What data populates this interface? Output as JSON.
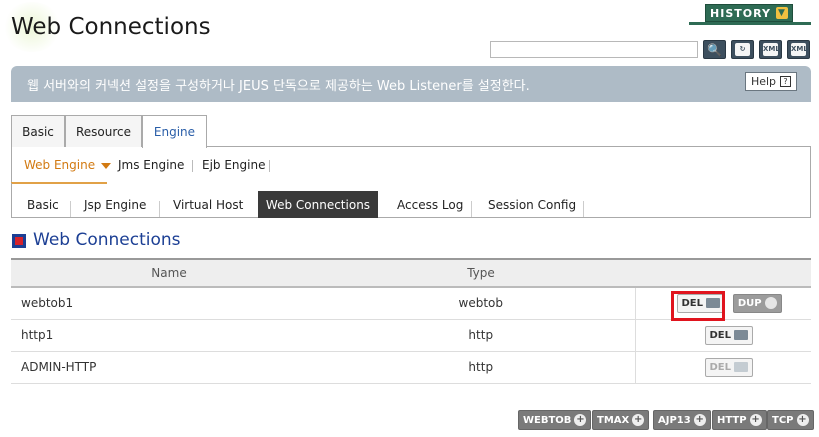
{
  "page_title": "Web Connections",
  "history_label": "HISTORY",
  "search": {
    "value": ""
  },
  "toolbar_icons": [
    "search-icon",
    "refresh-icon",
    "export-xml-icon",
    "import-xml-icon"
  ],
  "toolbar_xml": "XML",
  "banner": {
    "text": "웹 서버와의 커넥션 설정을 구성하거나 JEUS 단독으로 제공하는 Web Listener를 설정한다.",
    "help_label": "Help"
  },
  "tabs": [
    {
      "label": "Basic"
    },
    {
      "label": "Resource"
    },
    {
      "label": "Engine"
    }
  ],
  "engine_tabs": [
    {
      "label": "Web Engine"
    },
    {
      "label": "Jms Engine"
    },
    {
      "label": "Ejb Engine"
    }
  ],
  "web_tabs": [
    {
      "label": "Basic"
    },
    {
      "label": "Jsp Engine"
    },
    {
      "label": "Virtual Host"
    },
    {
      "label": "Web Connections"
    },
    {
      "label": "Access Log"
    },
    {
      "label": "Session Config"
    }
  ],
  "section_title": "Web Connections",
  "table": {
    "headers": [
      "Name",
      "Type"
    ],
    "rows": [
      {
        "name": "webtob1",
        "type": "webtob"
      },
      {
        "name": "http1",
        "type": "http"
      },
      {
        "name": "ADMIN-HTTP",
        "type": "http"
      }
    ]
  },
  "row_buttons": {
    "del": "DEL",
    "dup": "DUP"
  },
  "bottom_buttons": [
    "WEBTOB",
    "TMAX",
    "AJP13",
    "HTTP",
    "TCP"
  ],
  "colors": {
    "banner": "#aebbc6",
    "history": "#2e6b54",
    "highlight": "#e0141e",
    "active_tab_text": "#2a5ea8"
  }
}
